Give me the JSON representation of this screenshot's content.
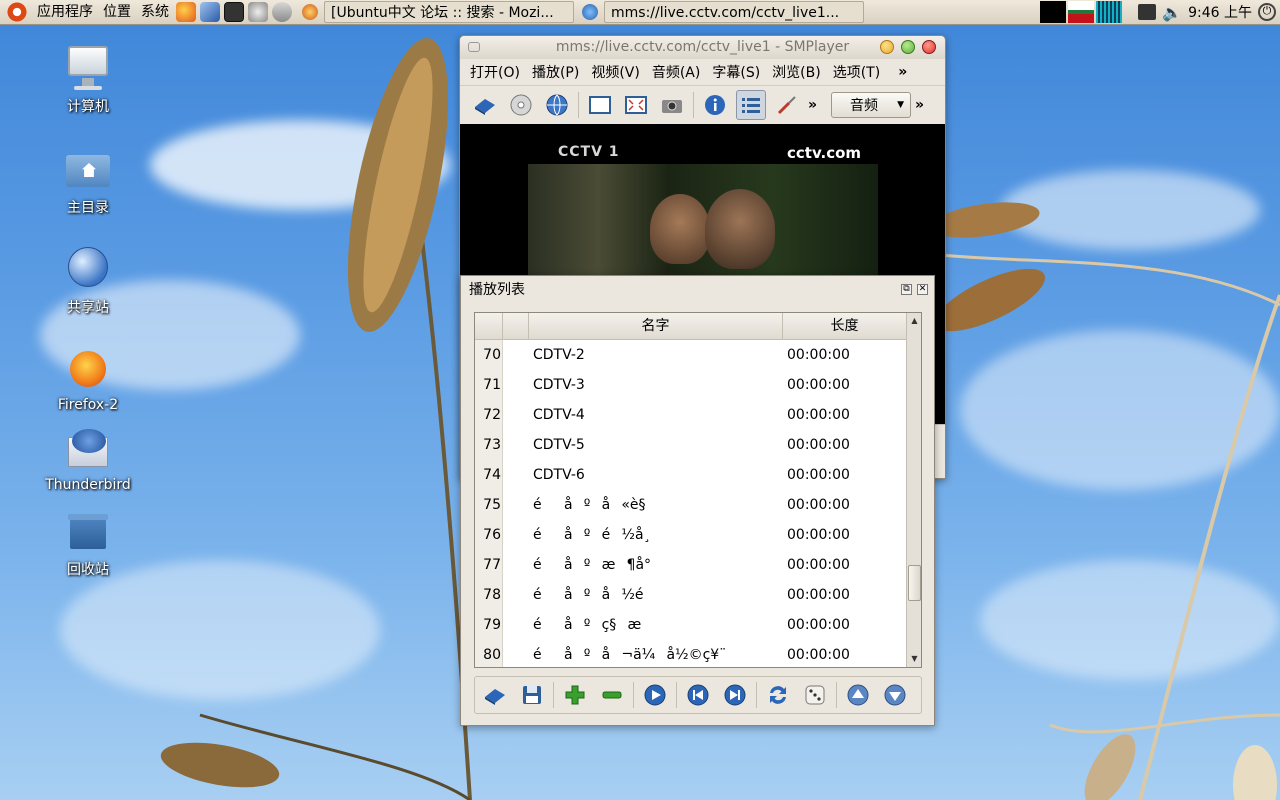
{
  "top_panel": {
    "menus": [
      "应用程序",
      "位置",
      "系统"
    ],
    "tasks": [
      "[Ubuntu中文 论坛 :: 搜索 - Mozi...",
      "mms://live.cctv.com/cctv_live1..."
    ],
    "clock": "9:46 上午"
  },
  "desktop_icons": [
    {
      "label": "计算机",
      "icon": "computer-icon"
    },
    {
      "label": "主目录",
      "icon": "home-folder-icon"
    },
    {
      "label": "共享站",
      "icon": "network-globe-icon"
    },
    {
      "label": "Firefox-2",
      "icon": "firefox-icon"
    },
    {
      "label": "Thunderbird",
      "icon": "thunderbird-icon"
    },
    {
      "label": "回收站",
      "icon": "trash-icon"
    }
  ],
  "smplayer": {
    "title": "mms://live.cctv.com/cctv_live1 - SMPlayer",
    "menu": [
      "打开(O)",
      "播放(P)",
      "视频(V)",
      "音频(A)",
      "字幕(S)",
      "浏览(B)",
      "选项(T)"
    ],
    "overflow": "»",
    "audio_select": "音频",
    "video_logo_left": "CCTV 1",
    "video_logo_right": "cctv.com"
  },
  "playlist": {
    "title": "播放列表",
    "columns": {
      "name": "名字",
      "length": "长度"
    },
    "rows": [
      {
        "num": "70",
        "name": "CDTV-2",
        "length": "00:00:00"
      },
      {
        "num": "71",
        "name": "CDTV-3",
        "length": "00:00:00"
      },
      {
        "num": "72",
        "name": "CDTV-4",
        "length": "00:00:00"
      },
      {
        "num": "73",
        "name": "CDTV-5",
        "length": "00:00:00"
      },
      {
        "num": "74",
        "name": "CDTV-6",
        "length": "00:00:00"
      },
      {
        "num": "75",
        "name": "éå\u0010ºå«è§",
        "length": "00:00:00"
      },
      {
        "num": "76",
        "name": "éå\u0010ºé½å¸",
        "length": "00:00:00"
      },
      {
        "num": "77",
        "name": "éå\u0010ºæ¶å°",
        "length": "00:00:00"
      },
      {
        "num": "78",
        "name": "éå\u0010ºå½é",
        "length": "00:00:00"
      },
      {
        "num": "79",
        "name": "éå\u0010ºç§æ",
        "length": "00:00:00"
      },
      {
        "num": "80",
        "name": "éå\u0010ºå¬ä¼å½©ç¥¨",
        "length": "00:00:00"
      }
    ]
  },
  "colors": {
    "panel": "#e4ddcd",
    "accent": "#2d6fc0",
    "close": "#d9322e",
    "minimize": "#e7a92f",
    "maximize": "#5cb03b"
  }
}
